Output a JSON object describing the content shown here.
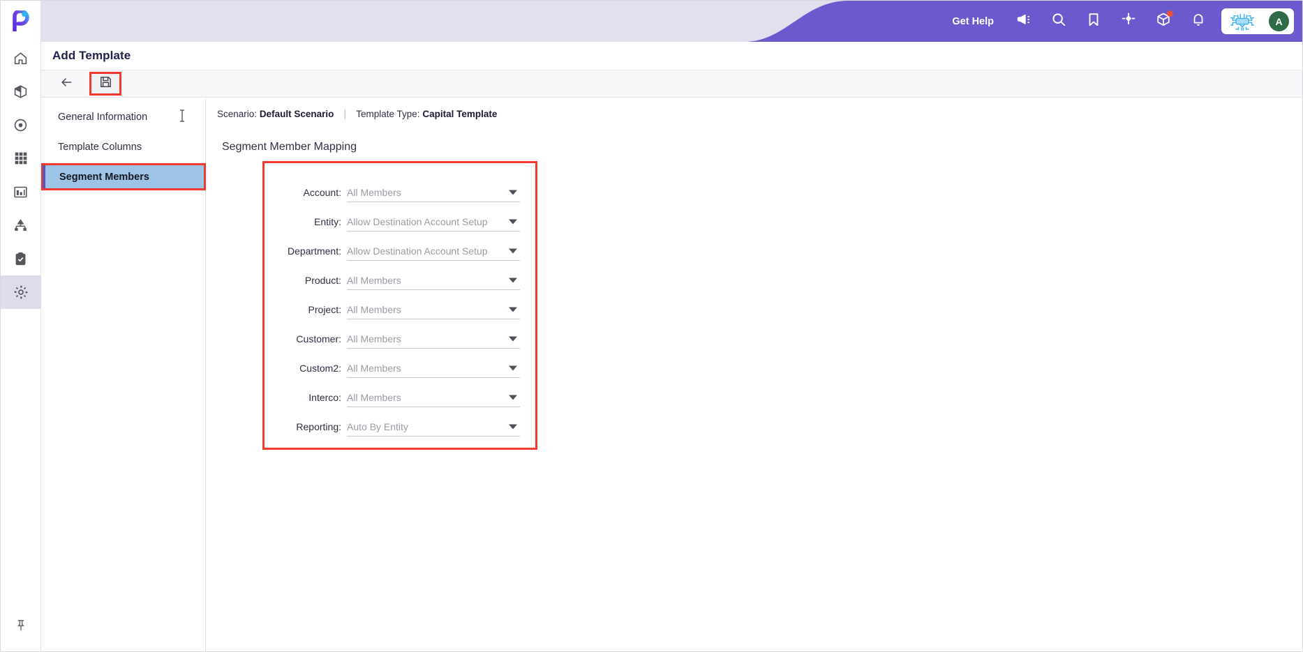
{
  "window": {
    "page_title": "Add Template"
  },
  "rail": {
    "logo": "planful-logo",
    "items": [
      {
        "name": "home",
        "icon": "home-icon",
        "active": false
      },
      {
        "name": "models",
        "icon": "cube-icon",
        "active": false
      },
      {
        "name": "target",
        "icon": "target-icon",
        "active": false
      },
      {
        "name": "grid",
        "icon": "grid-icon",
        "active": false
      },
      {
        "name": "reports",
        "icon": "bar-chart-icon",
        "active": false
      },
      {
        "name": "hierarchy",
        "icon": "hierarchy-icon",
        "active": false
      },
      {
        "name": "tasks",
        "icon": "clipboard-check-icon",
        "active": false
      },
      {
        "name": "settings",
        "icon": "gear-icon",
        "active": true
      }
    ],
    "bottom": {
      "name": "pin",
      "icon": "pin-icon"
    }
  },
  "topbar": {
    "get_help_label": "Get Help",
    "accent_color": "#6a5acd",
    "background_color": "#e3dfee",
    "icons": [
      {
        "name": "announcements",
        "icon": "megaphone-icon",
        "badge": false
      },
      {
        "name": "search",
        "icon": "search-icon",
        "badge": false
      },
      {
        "name": "bookmarks",
        "icon": "bookmark-icon",
        "badge": false
      },
      {
        "name": "quick-actions",
        "icon": "compass-icon",
        "badge": false
      },
      {
        "name": "packages",
        "icon": "box-icon",
        "badge": true
      },
      {
        "name": "notifications",
        "icon": "bell-icon",
        "badge": false
      }
    ],
    "user": {
      "ai_icon": "ai-chip-icon",
      "avatar_initial": "A",
      "avatar_color": "#2f6b46"
    }
  },
  "toolbar": {
    "back_label": "back-arrow",
    "save_label": "save-floppy",
    "save_highlighted": true,
    "highlight_color": "#f2392f"
  },
  "tabs": {
    "items": [
      {
        "label": "General Information",
        "active": false
      },
      {
        "label": "Template Columns",
        "active": false
      },
      {
        "label": "Segment Members",
        "active": true
      }
    ],
    "active_highlight_color": "#9dc3e6"
  },
  "breadcrumb": {
    "scenario_label": "Scenario:",
    "scenario_value": "Default Scenario",
    "separator": "|",
    "template_type_label": "Template Type:",
    "template_type_value": "Capital Template"
  },
  "form": {
    "section_title": "Segment Member Mapping",
    "highlighted": true,
    "fields": [
      {
        "label": "Account:",
        "value": "All Members"
      },
      {
        "label": "Entity:",
        "value": "Allow Destination Account Setup"
      },
      {
        "label": "Department:",
        "value": "Allow Destination Account Setup"
      },
      {
        "label": "Product:",
        "value": "All Members"
      },
      {
        "label": "Project:",
        "value": "All Members"
      },
      {
        "label": "Customer:",
        "value": "All Members"
      },
      {
        "label": "Custom2:",
        "value": "All Members"
      },
      {
        "label": "Interco:",
        "value": "All Members"
      },
      {
        "label": "Reporting:",
        "value": "Auto By Entity"
      }
    ]
  }
}
